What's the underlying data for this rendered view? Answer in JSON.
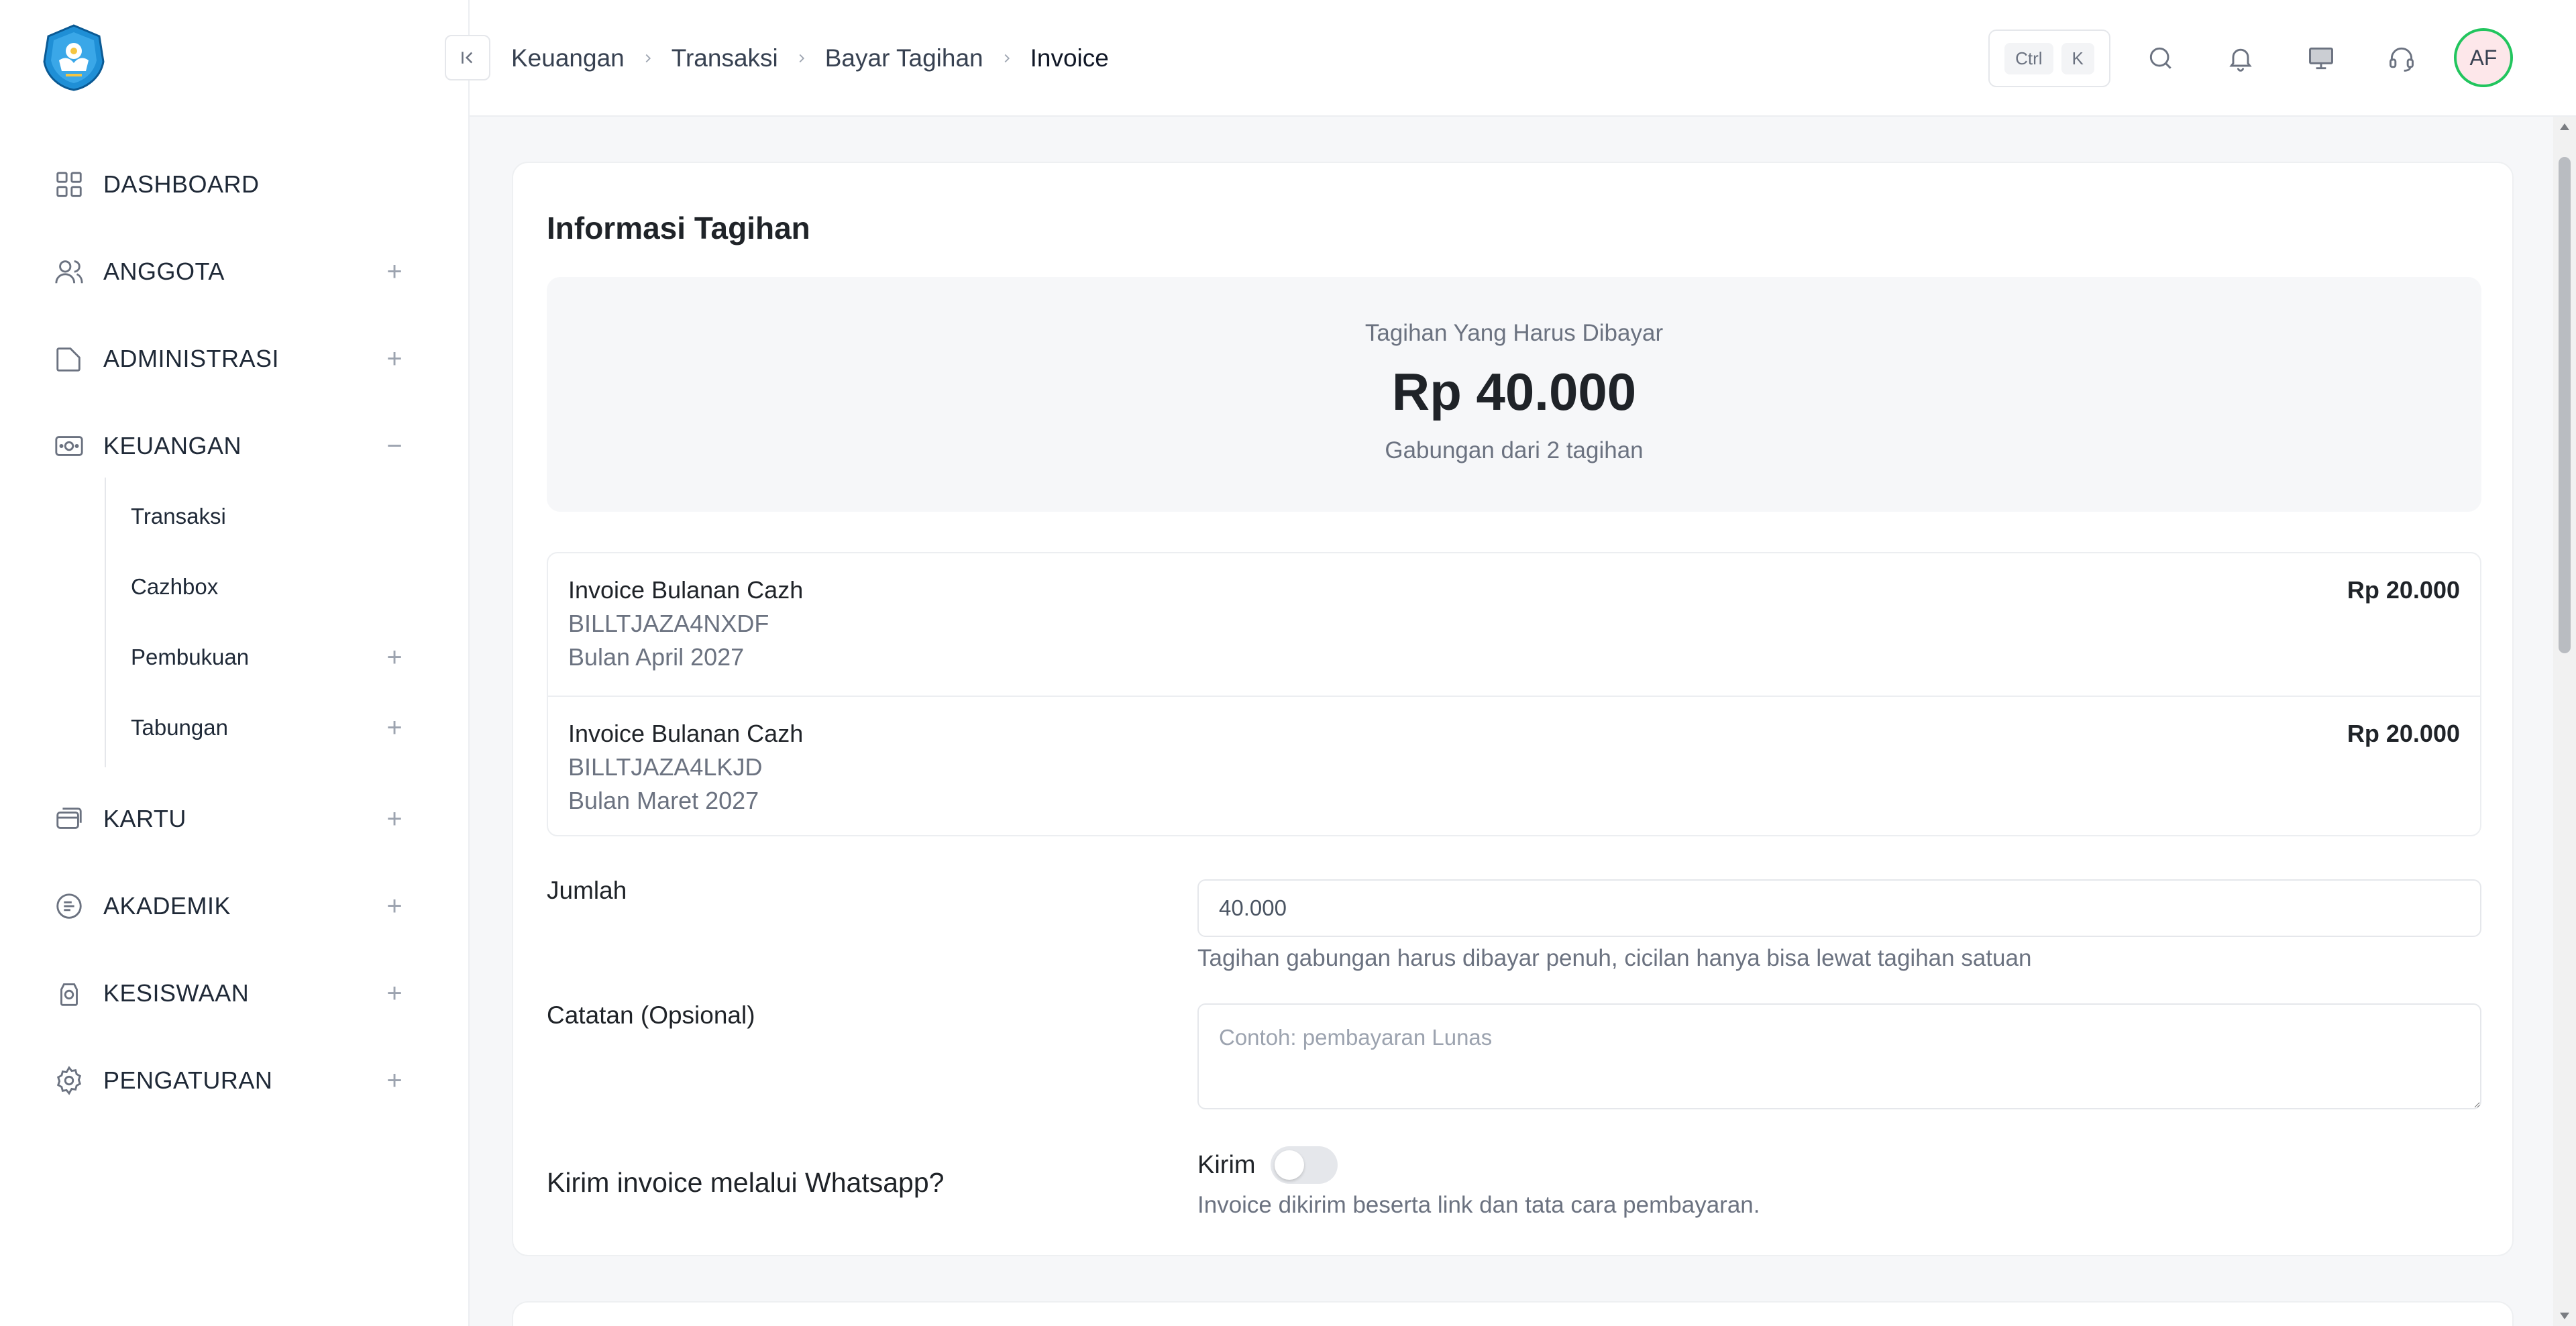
{
  "sidebar": {
    "items": [
      {
        "label": "DASHBOARD"
      },
      {
        "label": "ANGGOTA"
      },
      {
        "label": "ADMINISTRASI"
      },
      {
        "label": "KEUANGAN"
      },
      {
        "label": "KARTU"
      },
      {
        "label": "AKADEMIK"
      },
      {
        "label": "KESISWAAN"
      },
      {
        "label": "PENGATURAN"
      }
    ],
    "keuangan_sub": [
      {
        "label": "Transaksi"
      },
      {
        "label": "Cazhbox"
      },
      {
        "label": "Pembukuan"
      },
      {
        "label": "Tabungan"
      }
    ],
    "expand_symbol": "+",
    "collapse_symbol": "−"
  },
  "header": {
    "breadcrumb": [
      "Keuangan",
      "Transaksi",
      "Bayar Tagihan",
      "Invoice"
    ],
    "shortcut": {
      "ctrl": "Ctrl",
      "key": "K"
    },
    "avatar_initials": "AF",
    "avatar_ring_color": "#22c55e"
  },
  "card": {
    "title": "Informasi Tagihan",
    "summary": {
      "label": "Tagihan Yang Harus Dibayar",
      "amount": "Rp 40.000",
      "subtext": "Gabungan dari 2 tagihan"
    },
    "invoices": [
      {
        "name": "Invoice Bulanan Cazh",
        "code": "BILLTJAZA4NXDF",
        "period": "Bulan April 2027",
        "amount": "Rp 20.000"
      },
      {
        "name": "Invoice Bulanan Cazh",
        "code": "BILLTJAZA4LKJD",
        "period": "Bulan Maret 2027",
        "amount": "Rp 20.000"
      }
    ],
    "jumlah": {
      "label": "Jumlah",
      "value": "40.000",
      "help": "Tagihan gabungan harus dibayar penuh, cicilan hanya bisa lewat tagihan satuan"
    },
    "catatan": {
      "label": "Catatan (Opsional)",
      "placeholder": "Contoh: pembayaran Lunas"
    },
    "whatsapp": {
      "label": "Kirim invoice melalui Whatsapp?",
      "toggle_label": "Kirim",
      "toggle_on": false,
      "help": "Invoice dikirim beserta link dan tata cara pembayaran."
    }
  }
}
